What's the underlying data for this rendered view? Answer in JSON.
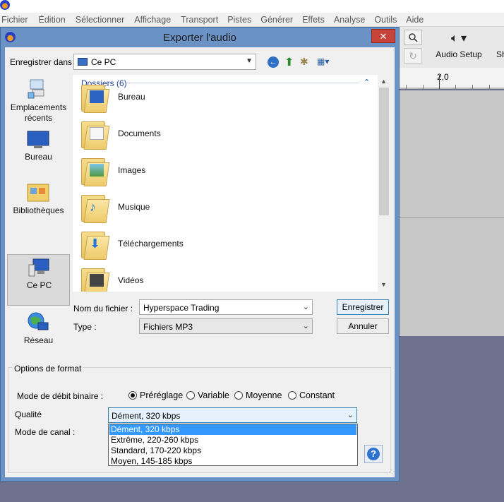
{
  "app": {
    "menu": [
      "Fichier",
      "Édition",
      "Sélectionner",
      "Affichage",
      "Transport",
      "Pistes",
      "Générer",
      "Effets",
      "Analyse",
      "Outils",
      "Aide"
    ],
    "toolbar": {
      "audio_setup_label": "Audio Setup",
      "cut_label": "Sh",
      "ruler_mark": "2,0",
      "zoom_icon": "magnifier-icon",
      "redo_icon": "redo-icon"
    }
  },
  "dialog": {
    "title": "Exporter l'audio",
    "close_label": "✕",
    "save_in": {
      "label": "Enregistrer dans :",
      "value": "Ce PC"
    },
    "places": [
      {
        "label": "Emplacements récents",
        "icon": "recent-places-icon"
      },
      {
        "label": "Bureau",
        "icon": "desktop-icon"
      },
      {
        "label": "Bibliothèques",
        "icon": "libraries-icon"
      },
      {
        "label": "Ce PC",
        "icon": "computer-icon",
        "selected": true
      },
      {
        "label": "Réseau",
        "icon": "network-icon"
      }
    ],
    "files": {
      "group_header": "Dossiers (6)",
      "items": [
        {
          "name": "Bureau",
          "icon": "folder-desktop-icon"
        },
        {
          "name": "Documents",
          "icon": "folder-documents-icon"
        },
        {
          "name": "Images",
          "icon": "folder-pictures-icon"
        },
        {
          "name": "Musique",
          "icon": "folder-music-icon"
        },
        {
          "name": "Téléchargements",
          "icon": "folder-downloads-icon"
        },
        {
          "name": "Vidéos",
          "icon": "folder-videos-icon"
        }
      ]
    },
    "filename": {
      "label": "Nom du fichier :",
      "value": "Hyperspace Trading"
    },
    "type": {
      "label": "Type :",
      "value": "Fichiers MP3"
    },
    "buttons": {
      "save": "Enregistrer",
      "cancel": "Annuler"
    },
    "format_options": {
      "title": "Options de format",
      "bitrate_mode_label": "Mode de débit binaire :",
      "bitrate_modes": [
        {
          "label": "Préréglage",
          "checked": true
        },
        {
          "label": "Variable",
          "checked": false
        },
        {
          "label": "Moyenne",
          "checked": false
        },
        {
          "label": "Constant",
          "checked": false
        }
      ],
      "quality_label": "Qualité",
      "quality_value": "Dément, 320 kbps",
      "quality_options": [
        "Dément, 320 kbps",
        "Extrême, 220-260 kbps",
        "Standard, 170-220 kbps",
        "Moyen, 145-185 kbps"
      ],
      "channel_mode_label": "Mode de canal :",
      "help_label": "?"
    }
  }
}
